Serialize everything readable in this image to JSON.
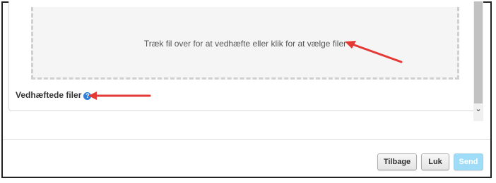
{
  "dropzone": {
    "text": "Træk fil over for at vedhæfte eller klik for at vælge filer"
  },
  "attachments": {
    "label": "Vedhæftede filer",
    "help_glyph": "?"
  },
  "scroll": {
    "down_glyph": "⌄"
  },
  "buttons": {
    "back": "Tilbage",
    "close": "Luk",
    "send": "Send"
  },
  "colors": {
    "arrow": "#e53935",
    "send_bg": "#9fdcf7",
    "help_icon": "#2f7fd6"
  }
}
